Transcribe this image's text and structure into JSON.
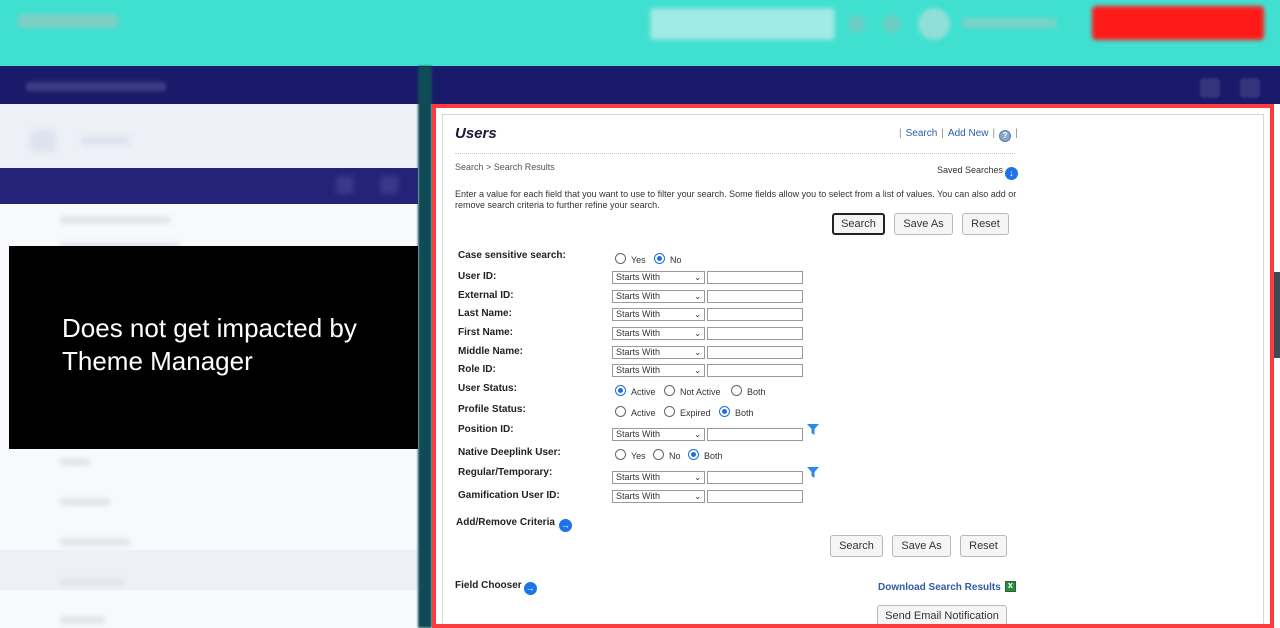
{
  "overlay": {
    "message": "Does not get impacted by Theme Manager"
  },
  "panel": {
    "title": "Users",
    "links": {
      "search": "Search",
      "add_new": "Add New"
    },
    "help_icon": "question-icon",
    "breadcrumb": "Search > Search Results",
    "saved_searches": "Saved Searches",
    "description": "Enter a value for each field that you want to use to filter your search. Some fields allow you to select from a list of values. You can also add or remove search criteria to further refine your search.",
    "buttons": {
      "search": "Search",
      "save_as": "Save As",
      "reset": "Reset"
    },
    "fields": {
      "case_sensitive": {
        "label": "Case sensitive search:",
        "options": [
          "Yes",
          "No"
        ],
        "selected": "No"
      },
      "user_id": {
        "label": "User ID:",
        "operator": "Starts With",
        "value": ""
      },
      "external_id": {
        "label": "External ID:",
        "operator": "Starts With",
        "value": ""
      },
      "last_name": {
        "label": "Last Name:",
        "operator": "Starts With",
        "value": ""
      },
      "first_name": {
        "label": "First Name:",
        "operator": "Starts With",
        "value": ""
      },
      "middle_name": {
        "label": "Middle Name:",
        "operator": "Starts With",
        "value": ""
      },
      "role_id": {
        "label": "Role ID:",
        "operator": "Starts With",
        "value": ""
      },
      "user_status": {
        "label": "User Status:",
        "options": [
          "Active",
          "Not Active",
          "Both"
        ],
        "selected": "Active"
      },
      "profile_status": {
        "label": "Profile Status:",
        "options": [
          "Active",
          "Expired",
          "Both"
        ],
        "selected": "Both"
      },
      "position_id": {
        "label": "Position ID:",
        "operator": "Starts With",
        "value": ""
      },
      "native_deeplink": {
        "label": "Native Deeplink User:",
        "options": [
          "Yes",
          "No",
          "Both"
        ],
        "selected": "Both"
      },
      "regular_temporary": {
        "label": "Regular/Temporary:",
        "operator": "Starts With",
        "value": ""
      },
      "gamification_id": {
        "label": "Gamification User ID:",
        "operator": "Starts With",
        "value": ""
      }
    },
    "add_remove_criteria": "Add/Remove Criteria",
    "field_chooser": "Field Chooser",
    "download_results": "Download Search Results",
    "send_email": "Send Email Notification"
  },
  "colors": {
    "topbar": "#40e0d0",
    "nav": "#1a1a6b",
    "highlight_border": "#ff3b3b",
    "link": "#2b5dab",
    "accent_icon": "#1e73e8"
  }
}
